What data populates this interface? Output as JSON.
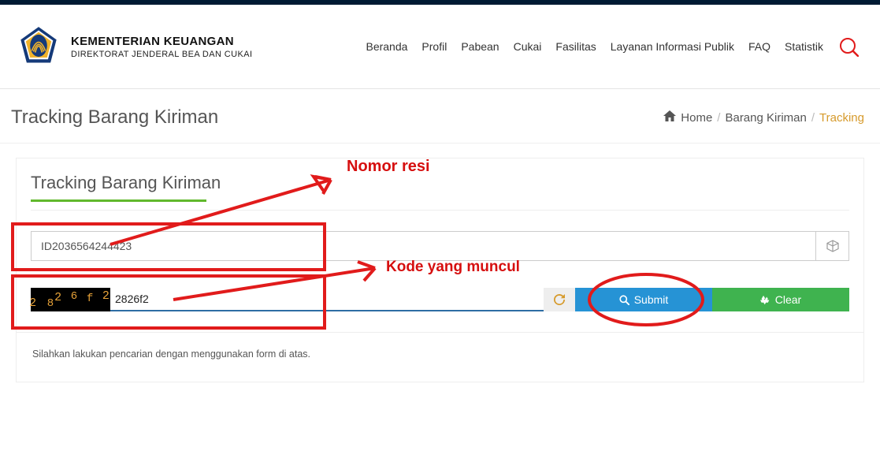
{
  "org": {
    "title": "KEMENTERIAN KEUANGAN",
    "subtitle": "DIREKTORAT JENDERAL BEA DAN CUKAI"
  },
  "nav": {
    "items": [
      {
        "label": "Beranda"
      },
      {
        "label": "Profil"
      },
      {
        "label": "Pabean"
      },
      {
        "label": "Cukai"
      },
      {
        "label": "Fasilitas"
      },
      {
        "label": "Layanan Informasi Publik"
      },
      {
        "label": "FAQ"
      },
      {
        "label": "Statistik"
      }
    ]
  },
  "page": {
    "title": "Tracking Barang Kiriman"
  },
  "breadcrumb": {
    "home": "Home",
    "mid": "Barang Kiriman",
    "active": "Tracking"
  },
  "form": {
    "section_title": "Tracking Barang Kiriman",
    "tracking_value": "ID2036564244423",
    "captcha_text": "2826f2",
    "captcha_value": "2826f2",
    "submit_label": "Submit",
    "clear_label": "Clear",
    "help_text": "Silahkan lakukan pencarian dengan menggunakan form di atas."
  },
  "annotations": {
    "label1": "Nomor resi",
    "label2": "Kode yang muncul"
  }
}
